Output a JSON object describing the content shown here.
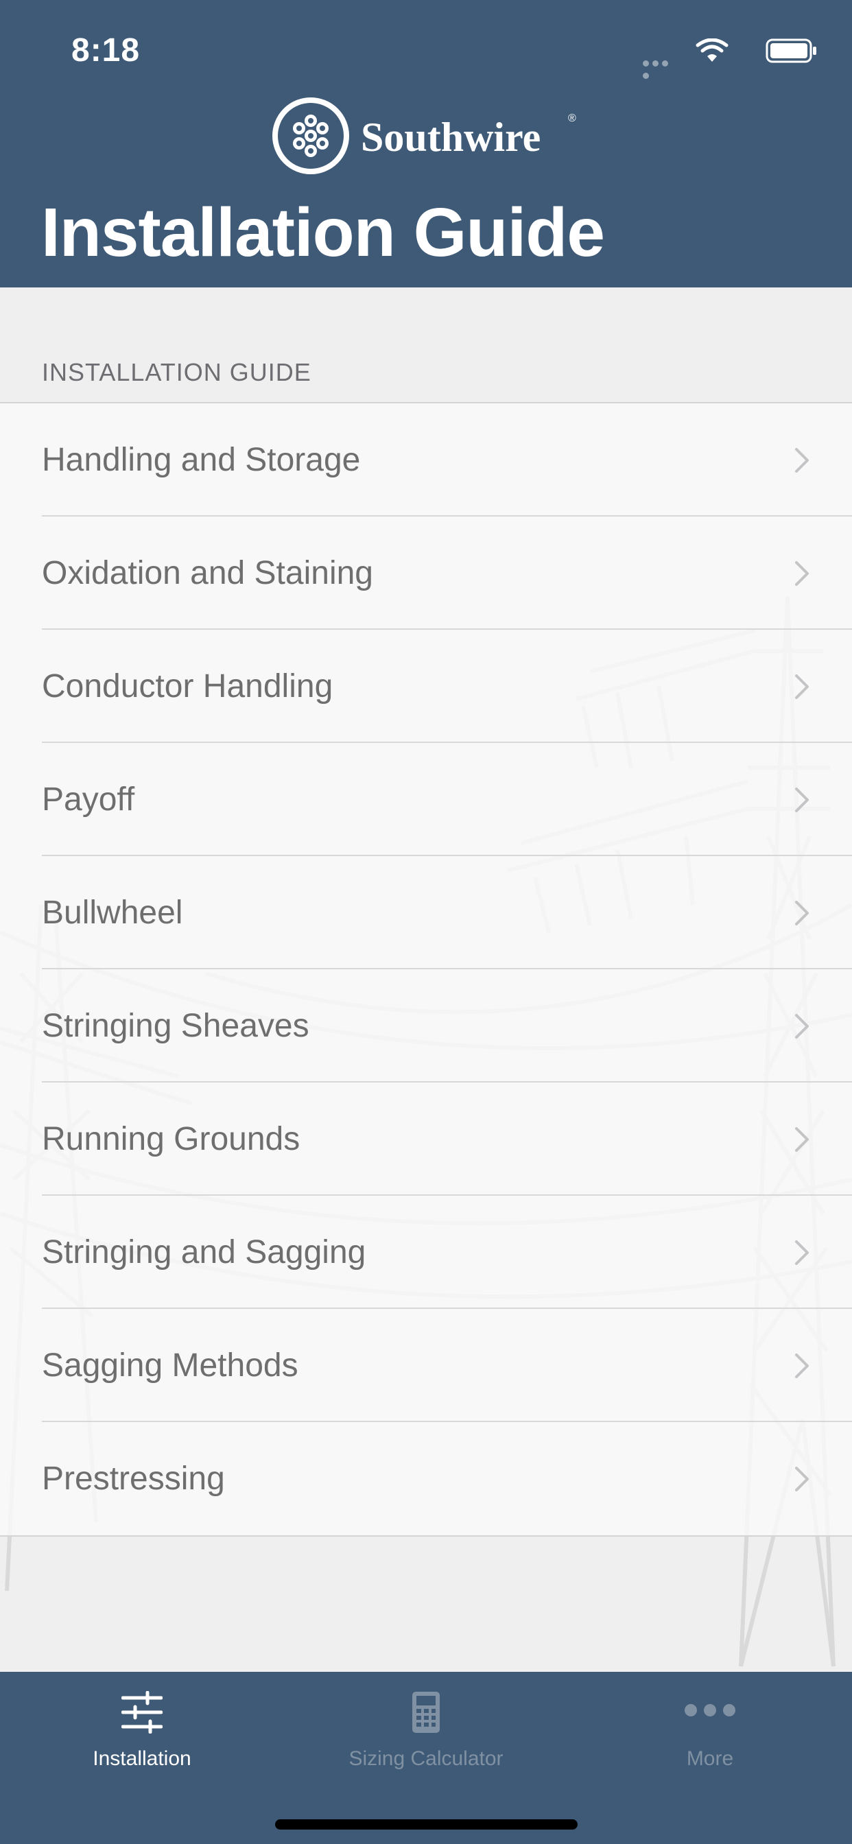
{
  "status_bar": {
    "time": "8:18"
  },
  "header": {
    "brand_name": "Southwire",
    "brand_mark": "®",
    "title": "Installation Guide"
  },
  "section": {
    "header": "INSTALLATION GUIDE"
  },
  "menu": {
    "items": [
      {
        "label": "Handling and Storage"
      },
      {
        "label": "Oxidation and Staining"
      },
      {
        "label": "Conductor Handling"
      },
      {
        "label": "Payoff"
      },
      {
        "label": "Bullwheel"
      },
      {
        "label": "Stringing Sheaves"
      },
      {
        "label": "Running Grounds"
      },
      {
        "label": "Stringing and Sagging"
      },
      {
        "label": "Sagging Methods"
      },
      {
        "label": "Prestressing"
      }
    ]
  },
  "tabs": [
    {
      "label": "Installation",
      "icon": "sliders-icon",
      "selected": true
    },
    {
      "label": "Sizing Calculator",
      "icon": "calculator-icon",
      "selected": false
    },
    {
      "label": "More",
      "icon": "more-dots-icon",
      "selected": false
    }
  ],
  "colors": {
    "header_bg": "#3f5a76",
    "content_bg": "#efefef",
    "row_text": "#6e6e6e",
    "tab_active": "#ffffff",
    "tab_inactive": "#7f91a3"
  }
}
